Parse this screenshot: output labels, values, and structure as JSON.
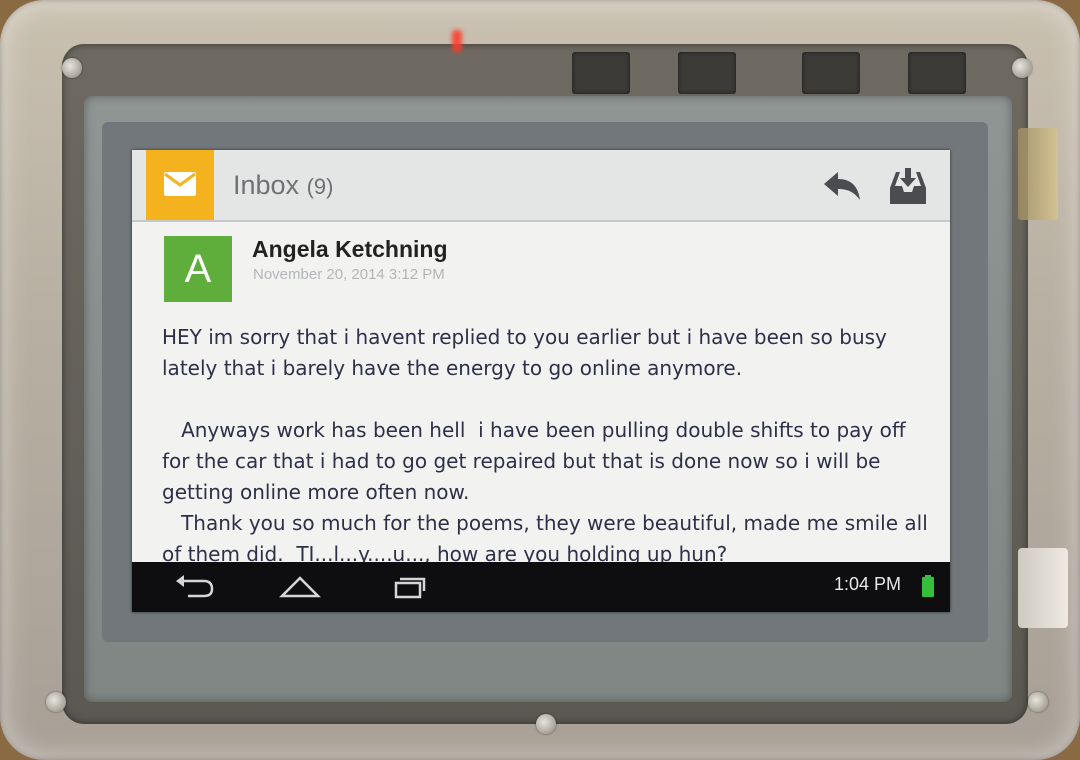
{
  "header": {
    "title": "Inbox",
    "unread_count": "(9)",
    "mail_icon": "envelope-icon",
    "reply_icon": "reply-icon",
    "archive_icon": "archive-download-icon"
  },
  "message": {
    "avatar_letter": "A",
    "sender": "Angela Ketchning",
    "date": "November 20, 2014  3:12 PM",
    "paragraphs": [
      "HEY im sorry that i havent replied to you earlier but i have been so busy lately that i barely have the energy to go online anymore.",
      "   Anyways work has been hell  i have been pulling double shifts to pay off for the car that i had to go get repaired but that is done now so i will be getting online more often now.",
      "   Thank you so much for the poems, they were beautiful, made me smile all of them did.  TI...l...y....u..., how are you holding up hun?"
    ]
  },
  "navbar": {
    "back_icon": "back-icon",
    "home_icon": "home-icon",
    "recents_icon": "recent-apps-icon",
    "time": "1:04 PM",
    "battery_icon": "battery-icon"
  },
  "colors": {
    "accent": "#f4b21f",
    "avatar": "#5fae3c",
    "battery": "#34c03a"
  }
}
